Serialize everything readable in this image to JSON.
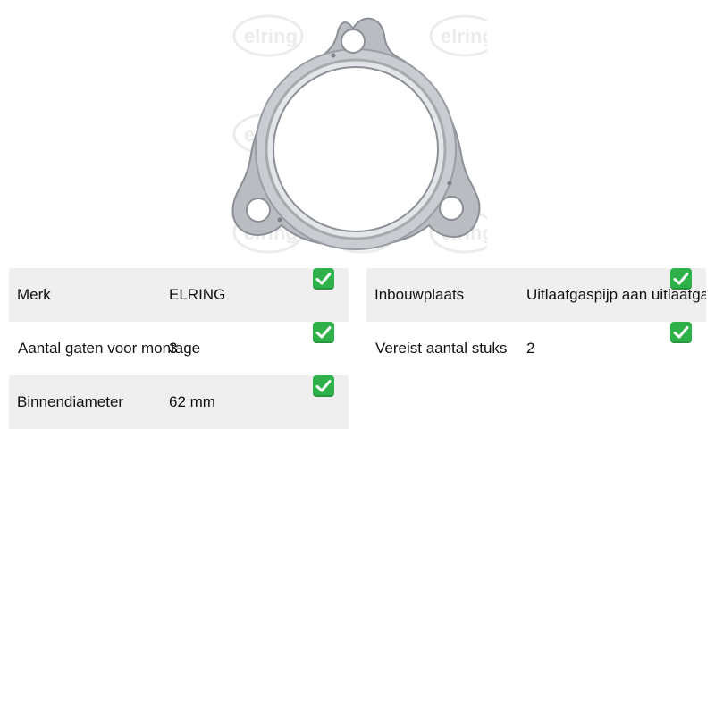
{
  "image": {
    "watermark_text": "elring"
  },
  "specs_left": [
    {
      "label": "Merk",
      "value": "ELRING",
      "checked": true
    },
    {
      "label": "Aantal gaten voor montage",
      "value": "3",
      "checked": true
    },
    {
      "label": "Binnendiameter",
      "value": "62 mm",
      "checked": true
    }
  ],
  "specs_right": [
    {
      "label": "Inbouwplaats",
      "value": "Uitlaatgaspijp aan uitlaatgas",
      "checked": true
    },
    {
      "label": "Vereist aantal stuks",
      "value": "2",
      "checked": true
    }
  ],
  "colors": {
    "row_shade": "#efefef",
    "check_green": "#2fb14a"
  },
  "icons": {
    "check": "white-check-mark-icon"
  }
}
